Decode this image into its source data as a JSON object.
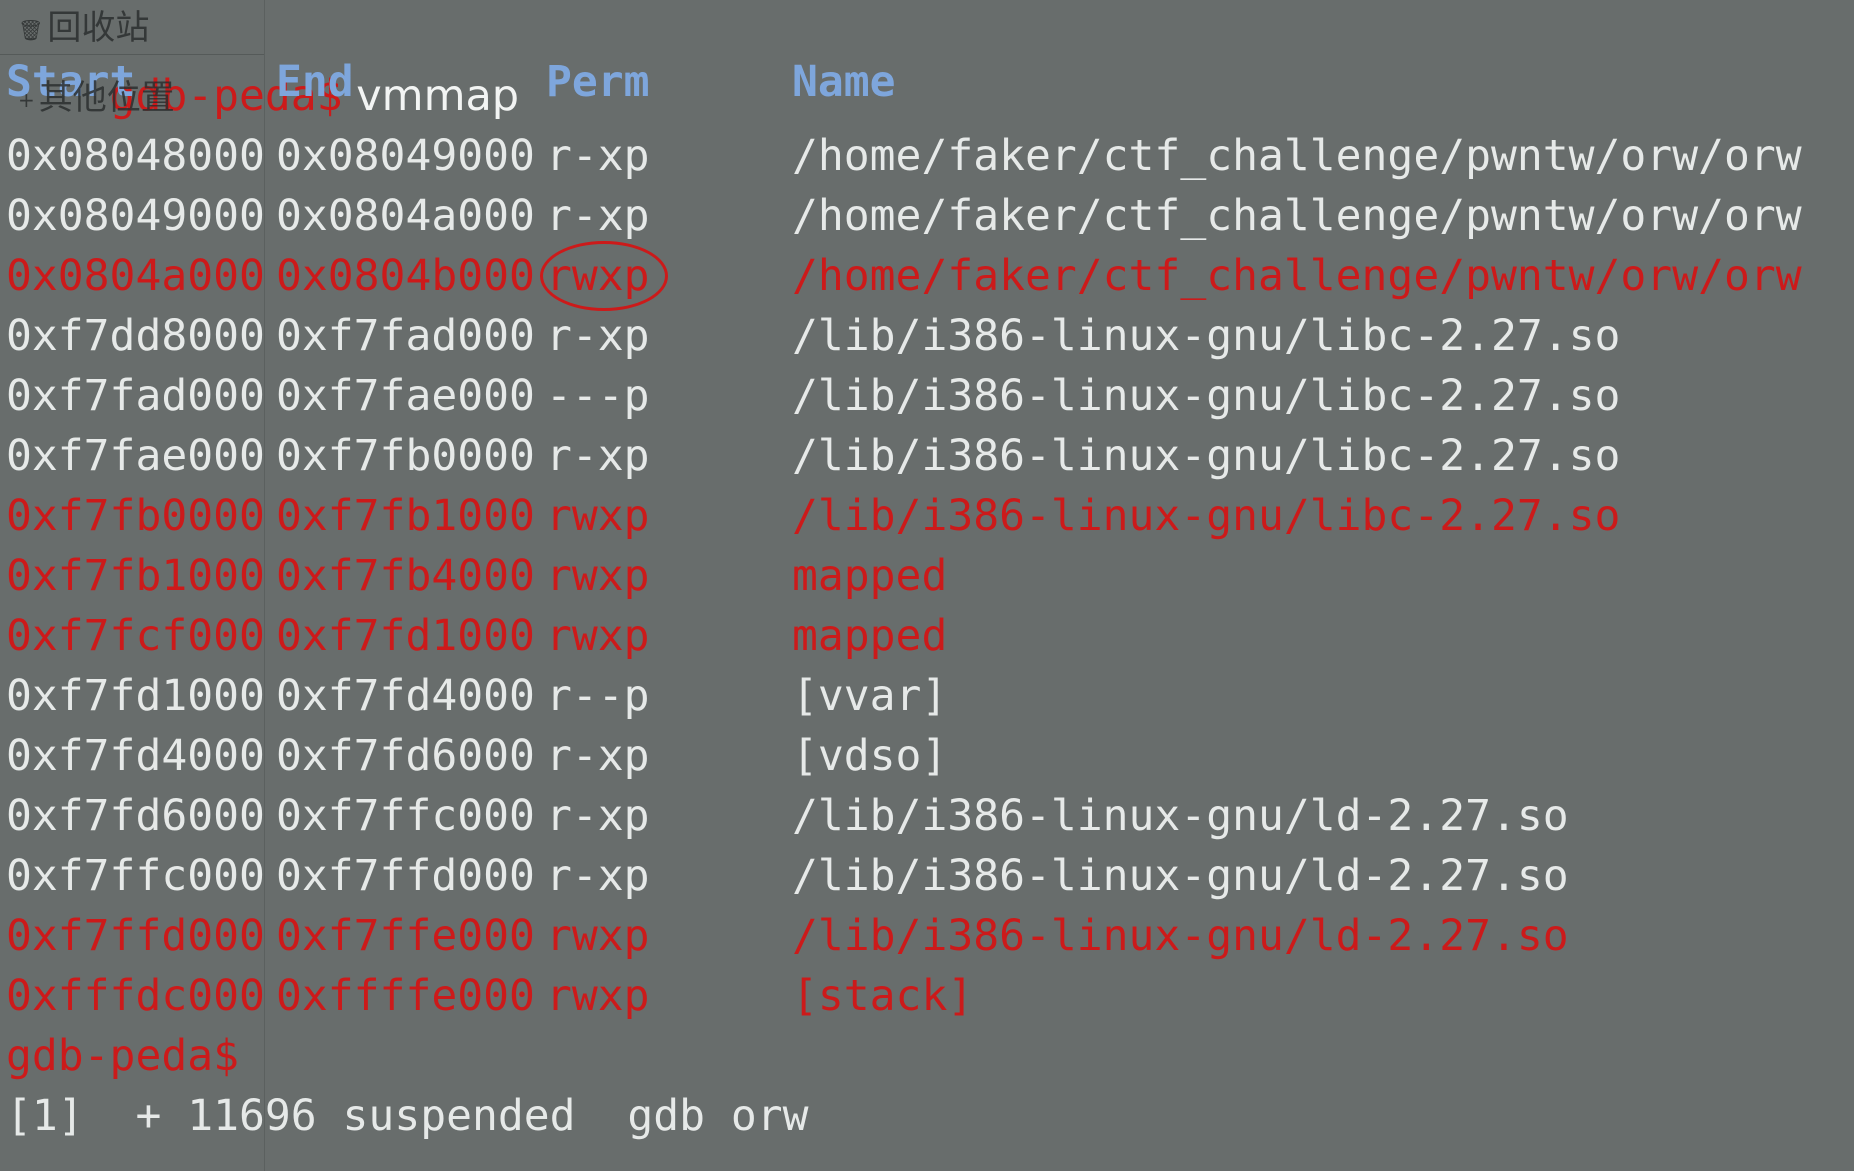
{
  "sidebar": {
    "trash_label": "回收站",
    "other_locations_label": "其他位置"
  },
  "prompt": "gdb-peda$",
  "command": " vmmap",
  "headers": {
    "start": "Start",
    "end": "End",
    "perm": "Perm",
    "name": "Name"
  },
  "rows": [
    {
      "start": "0x08048000",
      "end": "0x08049000",
      "perm": "r-xp",
      "name": "/home/faker/ctf_challenge/pwntw/orw/orw",
      "highlight": false
    },
    {
      "start": "0x08049000",
      "end": "0x0804a000",
      "perm": "r-xp",
      "name": "/home/faker/ctf_challenge/pwntw/orw/orw",
      "highlight": false
    },
    {
      "start": "0x0804a000",
      "end": "0x0804b000",
      "perm": "rwxp",
      "name": "/home/faker/ctf_challenge/pwntw/orw/orw",
      "highlight": true
    },
    {
      "start": "0xf7dd8000",
      "end": "0xf7fad000",
      "perm": "r-xp",
      "name": "/lib/i386-linux-gnu/libc-2.27.so",
      "highlight": false
    },
    {
      "start": "0xf7fad000",
      "end": "0xf7fae000",
      "perm": "---p",
      "name": "/lib/i386-linux-gnu/libc-2.27.so",
      "highlight": false
    },
    {
      "start": "0xf7fae000",
      "end": "0xf7fb0000",
      "perm": "r-xp",
      "name": "/lib/i386-linux-gnu/libc-2.27.so",
      "highlight": false
    },
    {
      "start": "0xf7fb0000",
      "end": "0xf7fb1000",
      "perm": "rwxp",
      "name": "/lib/i386-linux-gnu/libc-2.27.so",
      "highlight": true
    },
    {
      "start": "0xf7fb1000",
      "end": "0xf7fb4000",
      "perm": "rwxp",
      "name": "mapped",
      "highlight": true
    },
    {
      "start": "0xf7fcf000",
      "end": "0xf7fd1000",
      "perm": "rwxp",
      "name": "mapped",
      "highlight": true
    },
    {
      "start": "0xf7fd1000",
      "end": "0xf7fd4000",
      "perm": "r--p",
      "name": "[vvar]",
      "highlight": false
    },
    {
      "start": "0xf7fd4000",
      "end": "0xf7fd6000",
      "perm": "r-xp",
      "name": "[vdso]",
      "highlight": false
    },
    {
      "start": "0xf7fd6000",
      "end": "0xf7ffc000",
      "perm": "r-xp",
      "name": "/lib/i386-linux-gnu/ld-2.27.so",
      "highlight": false
    },
    {
      "start": "0xf7ffc000",
      "end": "0xf7ffd000",
      "perm": "r-xp",
      "name": "/lib/i386-linux-gnu/ld-2.27.so",
      "highlight": false
    },
    {
      "start": "0xf7ffd000",
      "end": "0xf7ffe000",
      "perm": "rwxp",
      "name": "/lib/i386-linux-gnu/ld-2.27.so",
      "highlight": true
    },
    {
      "start": "0xfffdc000",
      "end": "0xffffe000",
      "perm": "rwxp",
      "name": "[stack]",
      "highlight": true
    }
  ],
  "final_prompt": "gdb-peda$",
  "job_status": "[1]  + 11696 suspended  gdb orw",
  "colors": {
    "background": "#686d6c",
    "text": "#e6e9e8",
    "highlight": "#cc1a1a",
    "header": "#7ea6dc",
    "annotation": "#cc1a1a"
  }
}
